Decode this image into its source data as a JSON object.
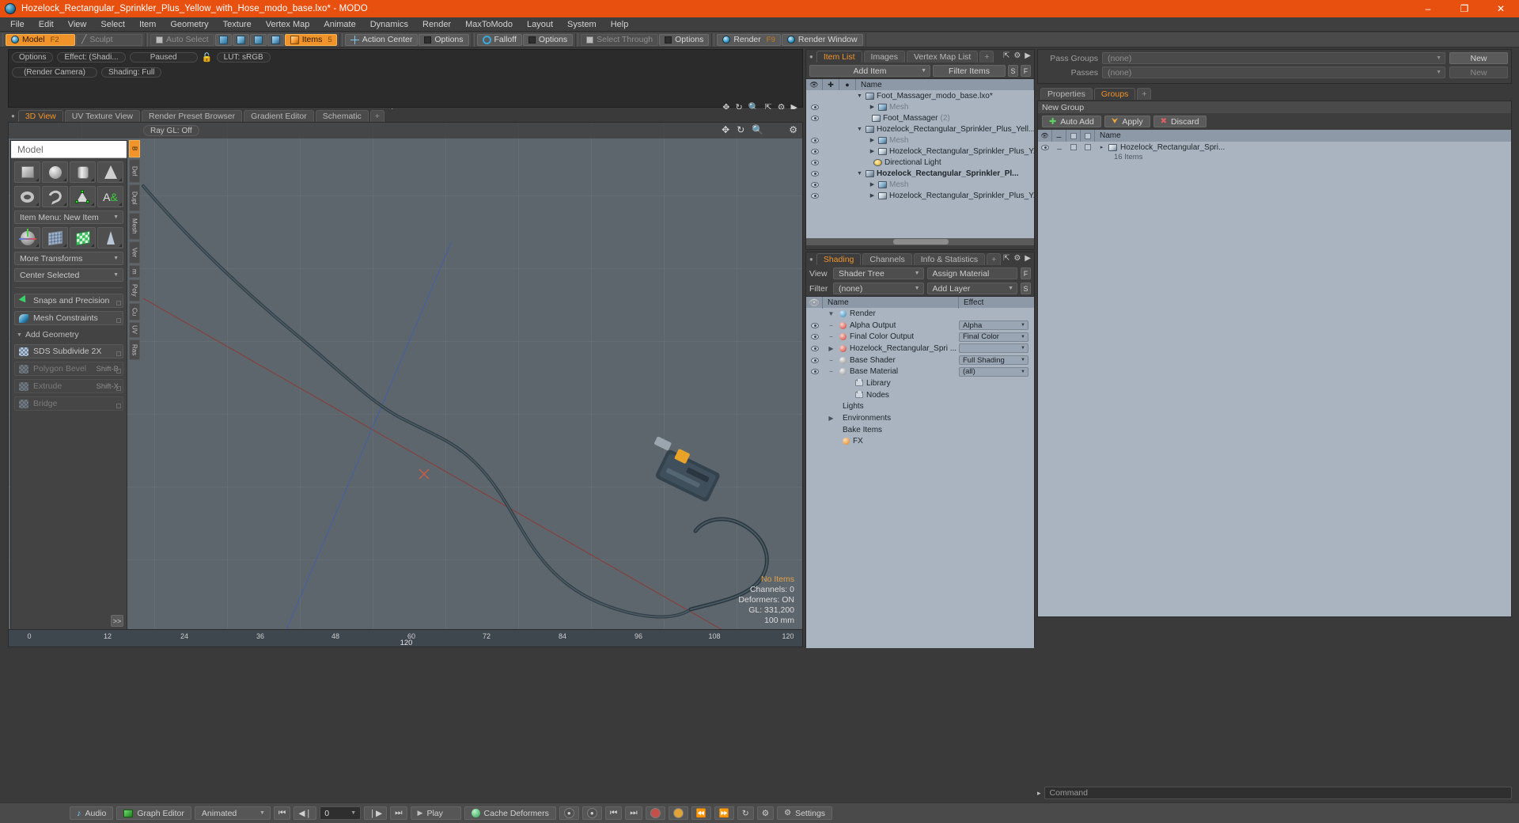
{
  "window": {
    "title": "Hozelock_Rectangular_Sprinkler_Plus_Yellow_with_Hose_modo_base.lxo* - MODO",
    "app_icon": "modo-sphere-icon",
    "minimize": "–",
    "maximize": "❐",
    "close": "✕",
    "accent": "#e8500f"
  },
  "menubar": {
    "items": [
      "File",
      "Edit",
      "View",
      "Select",
      "Item",
      "Geometry",
      "Texture",
      "Vertex Map",
      "Animate",
      "Dynamics",
      "Render",
      "MaxToModo",
      "Layout",
      "System",
      "Help"
    ]
  },
  "modebar": {
    "model": "Model",
    "model_hotkey": "F2",
    "sculpt": "Sculpt",
    "auto_select": "Auto Select",
    "items": "Items",
    "items_hotkey": "5",
    "action_center": "Action Center",
    "options1": "Options",
    "falloff": "Falloff",
    "options2": "Options",
    "select_through": "Select Through",
    "options3": "Options",
    "render": "Render",
    "render_hotkey": "F9",
    "render_window": "Render Window"
  },
  "render_preview": {
    "options": "Options",
    "effect": "Effect: (Shadi...",
    "status": "Paused",
    "lock_icon": "unlock-icon",
    "lut": "LUT: sRGB",
    "camera": "(Render Camera)",
    "shading": "Shading: Full",
    "play_icon": "play-triangle-icon",
    "icons": [
      "pan-icon",
      "rotate-icon",
      "zoom-icon",
      "fit-icon",
      "gear-icon",
      "arrow-icon"
    ]
  },
  "viewport": {
    "tabs": [
      "3D View",
      "UV Texture View",
      "Render Preset Browser",
      "Gradient Editor",
      "Schematic",
      "+"
    ],
    "active_tab": "3D View",
    "raygl": "Ray GL: Off",
    "icons": [
      "pan-icon",
      "rotate-icon",
      "zoom-icon",
      "gear-icon"
    ],
    "stats": {
      "items": "No Items",
      "channels": "Channels: 0",
      "deformers": "Deformers: ON",
      "gl": "GL: 331,200",
      "scale": "100 mm"
    },
    "ruler_ticks": [
      "0",
      "12",
      "24",
      "36",
      "48",
      "60",
      "72",
      "84",
      "96",
      "108",
      "120"
    ],
    "ruler_center": "120",
    "ruler_right": "120"
  },
  "toolbox": {
    "header": "Model",
    "primitives_row1": [
      {
        "name": "cube-tool",
        "icon": "cube-icon"
      },
      {
        "name": "sphere-tool",
        "icon": "sphere-icon"
      },
      {
        "name": "cylinder-tool",
        "icon": "cylinder-icon"
      },
      {
        "name": "cone-tool",
        "icon": "cone-icon"
      }
    ],
    "primitives_row2": [
      {
        "name": "torus-tool",
        "icon": "torus-icon"
      },
      {
        "name": "tube-tool",
        "icon": "spiral-icon"
      },
      {
        "name": "polygon-tool",
        "icon": "polygon-icon"
      },
      {
        "name": "text-tool",
        "icon": "text-icon"
      }
    ],
    "item_menu": "Item Menu: New Item",
    "transform_row": [
      {
        "name": "transform-tool",
        "icon": "axis-icon"
      },
      {
        "name": "bend-tool",
        "icon": "grid-icon"
      },
      {
        "name": "shear-tool",
        "icon": "green-grid-icon"
      },
      {
        "name": "taper-tool",
        "icon": "taper-icon"
      }
    ],
    "more_transforms": "More Transforms",
    "center_selected": "Center Selected",
    "snaps": "Snaps and Precision",
    "mesh_constraints": "Mesh Constraints",
    "add_geometry": "Add Geometry",
    "sds_subdivide": "SDS Subdivide 2X",
    "polygon_bevel": "Polygon Bevel",
    "polygon_bevel_hk": "Shift-B",
    "extrude": "Extrude",
    "extrude_hk": "Shift-X",
    "bridge": "Bridge",
    "more_button": ">>"
  },
  "mode_strip": [
    "B",
    "Def",
    "Dupl",
    "Mesh",
    "Ver",
    "m",
    "Poly",
    "Cu",
    "UV",
    "Ras"
  ],
  "item_list": {
    "tabs": [
      "Item List",
      "Images",
      "Vertex Map List",
      "+"
    ],
    "active_tab": "Item List",
    "add_item": "Add Item",
    "filter_items": "Filter Items",
    "btn_s": "S",
    "btn_f": "F",
    "col_name": "Name",
    "rows": [
      {
        "indent": 1,
        "twisty": "▼",
        "icon": "scene-icon",
        "name": "Foot_Massager_modo_base.lxo*",
        "bold": false,
        "count": ""
      },
      {
        "indent": 3,
        "twisty": "▶",
        "icon": "mesh-icon",
        "name": "Mesh",
        "bold": false,
        "dim": true,
        "count": ""
      },
      {
        "indent": 2,
        "twisty": "",
        "icon": "group-icon",
        "name": "Foot_Massager",
        "bold": false,
        "count": "(2)"
      },
      {
        "indent": 1,
        "twisty": "▼",
        "icon": "scene-icon",
        "name": "Hozelock_Rectangular_Sprinkler_Plus_Yell...",
        "bold": false,
        "count": ""
      },
      {
        "indent": 3,
        "twisty": "▶",
        "icon": "mesh-icon",
        "name": "Mesh",
        "bold": false,
        "dim": true,
        "count": ""
      },
      {
        "indent": 3,
        "twisty": "▶",
        "icon": "item-icon",
        "name": "Hozelock_Rectangular_Sprinkler_Plus_Y...",
        "bold": false,
        "count": ""
      },
      {
        "indent": 3,
        "twisty": "",
        "icon": "light-icon",
        "name": "Directional Light",
        "bold": false,
        "count": ""
      },
      {
        "indent": 1,
        "twisty": "▼",
        "icon": "scene-icon",
        "name": "Hozelock_Rectangular_Sprinkler_Pl...",
        "bold": true,
        "count": ""
      },
      {
        "indent": 3,
        "twisty": "▶",
        "icon": "mesh-icon",
        "name": "Mesh",
        "bold": false,
        "dim": true,
        "count": ""
      },
      {
        "indent": 3,
        "twisty": "▶",
        "icon": "item-icon",
        "name": "Hozelock_Rectangular_Sprinkler_Plus_Y...",
        "bold": false,
        "count": ""
      }
    ]
  },
  "shading": {
    "tabs": [
      "Shading",
      "Channels",
      "Info & Statistics",
      "+"
    ],
    "active_tab": "Shading",
    "view_label": "View",
    "view_value": "Shader Tree",
    "assign_material": "Assign Material",
    "btn_f": "F",
    "filter_label": "Filter",
    "filter_value": "(none)",
    "add_layer": "Add Layer",
    "btn_s": "S",
    "col_name": "Name",
    "col_effect": "Effect",
    "rows": [
      {
        "indent": 1,
        "twisty": "▼",
        "dot": "blue",
        "name": "Render",
        "effect": "",
        "eye": false
      },
      {
        "indent": 2,
        "twisty": "",
        "dot": "red",
        "name": "Alpha Output",
        "effect": "Alpha",
        "eye": true
      },
      {
        "indent": 2,
        "twisty": "",
        "dot": "red",
        "name": "Final Color Output",
        "effect": "Final Color",
        "eye": true
      },
      {
        "indent": 2,
        "twisty": "▶",
        "dot": "red",
        "name": "Hozelock_Rectangular_Spri  ...",
        "effect": "",
        "eye": true
      },
      {
        "indent": 2,
        "twisty": "",
        "dot": "grey",
        "name": "Base Shader",
        "effect": "Full Shading",
        "eye": true
      },
      {
        "indent": 2,
        "twisty": "",
        "dot": "grey",
        "name": "Base Material",
        "effect": "(all)",
        "eye": true
      },
      {
        "indent": 2,
        "twisty": "",
        "dot": "folder",
        "name": "Library",
        "effect": "",
        "eye": false
      },
      {
        "indent": 2,
        "twisty": "",
        "dot": "folder",
        "name": "Nodes",
        "effect": "",
        "eye": false
      },
      {
        "indent": 1,
        "twisty": "",
        "dot": "",
        "name": "Lights",
        "effect": "",
        "eye": false
      },
      {
        "indent": 1,
        "twisty": "▶",
        "dot": "",
        "name": "Environments",
        "effect": "",
        "eye": false
      },
      {
        "indent": 1,
        "twisty": "",
        "dot": "",
        "name": "Bake Items",
        "effect": "",
        "eye": false
      },
      {
        "indent": 1,
        "twisty": "",
        "dot": "orange",
        "name": "FX",
        "effect": "",
        "eye": false
      }
    ]
  },
  "right_panel": {
    "pass_groups_label": "Pass Groups",
    "pass_groups_value": "(none)",
    "new_button": "New",
    "passes_label": "Passes",
    "passes_value": "(none)",
    "new_button2": "New",
    "tabs": [
      "Properties",
      "Groups",
      "+"
    ],
    "active_tab": "Groups",
    "group_header": "New Group",
    "auto_add": "Auto Add",
    "apply": "Apply",
    "discard": "Discard",
    "col_name": "Name",
    "item_name": "Hozelock_Rectangular_Spri...",
    "item_sub": "16 Items"
  },
  "bottombar": {
    "audio": "Audio",
    "graph_editor": "Graph Editor",
    "animated": "Animated",
    "frame": "0",
    "play": "Play",
    "cache_deformers": "Cache Deformers",
    "settings": "Settings",
    "transport": {
      "start": "⏮",
      "prev": "◀❘",
      "next": "❘▶",
      "end": "⏭",
      "play_icon": "▶"
    },
    "command_placeholder": "Command"
  }
}
